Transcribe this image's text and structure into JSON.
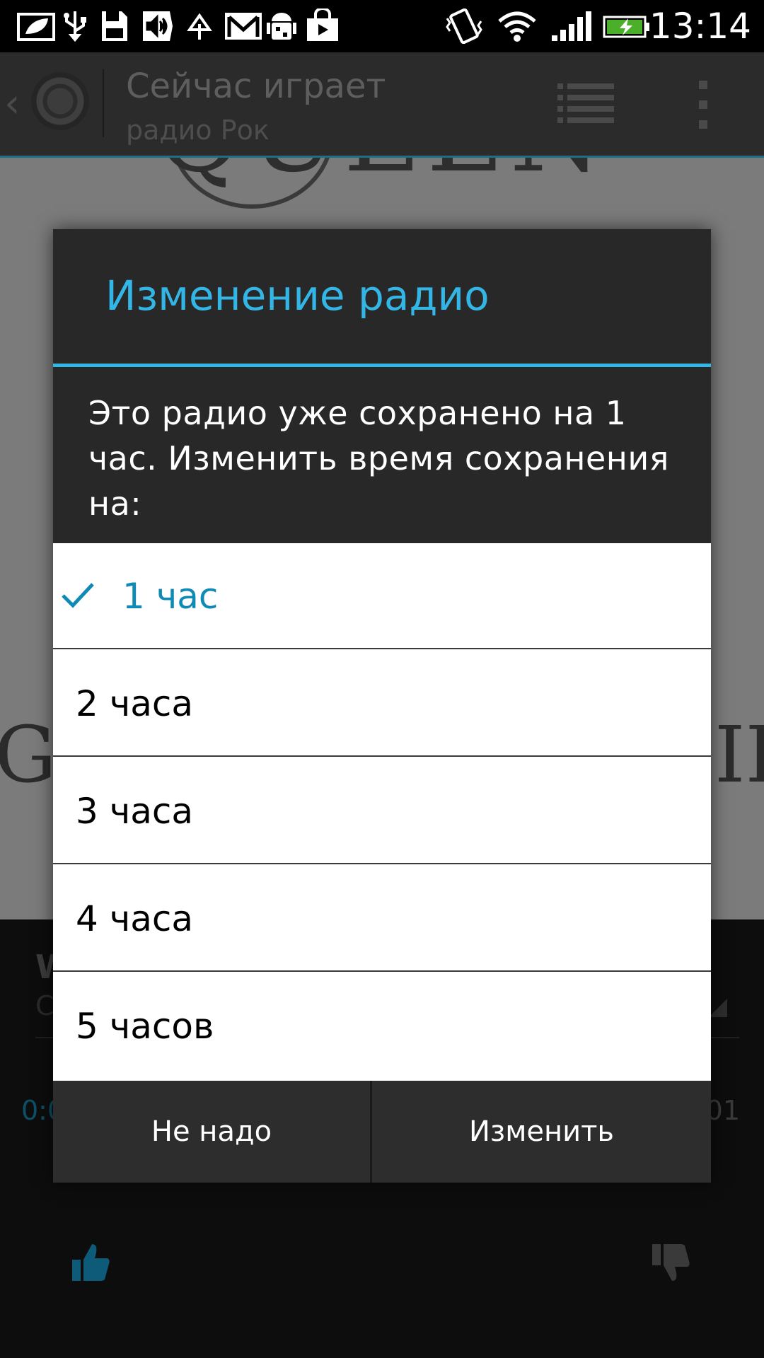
{
  "status_bar": {
    "time": "13:14",
    "icons": [
      "leaf-screen-icon",
      "usb-icon",
      "sd-card-icon",
      "sound-icon",
      "upload-icon",
      "gmail-icon",
      "android-debug-icon",
      "play-store-icon",
      "vibrate-icon",
      "wifi-icon",
      "signal-icon",
      "battery-charging-icon"
    ]
  },
  "action_bar": {
    "title": "Сейчас играет",
    "subtitle": "радио Рок"
  },
  "background": {
    "album_top_text": "QUEEN",
    "album_bottom_text": "G",
    "album_bottom_right": "III",
    "track_initial": "W",
    "artist_initial": "C",
    "time_elapsed": "0:0",
    "time_total": "01"
  },
  "dialog": {
    "title": "Изменение радио",
    "message": "Это радио уже сохранено на 1 час. Изменить время сохранения на:",
    "options": [
      {
        "label": "1 час",
        "selected": true
      },
      {
        "label": "2 часа",
        "selected": false
      },
      {
        "label": "3 часа",
        "selected": false
      },
      {
        "label": "4 часа",
        "selected": false
      },
      {
        "label": "5 часов",
        "selected": false
      }
    ],
    "cancel_label": "Не надо",
    "confirm_label": "Изменить"
  },
  "colors": {
    "accent": "#33b5e5",
    "selected_text": "#0e8ab4",
    "dialog_bg": "#282828"
  }
}
